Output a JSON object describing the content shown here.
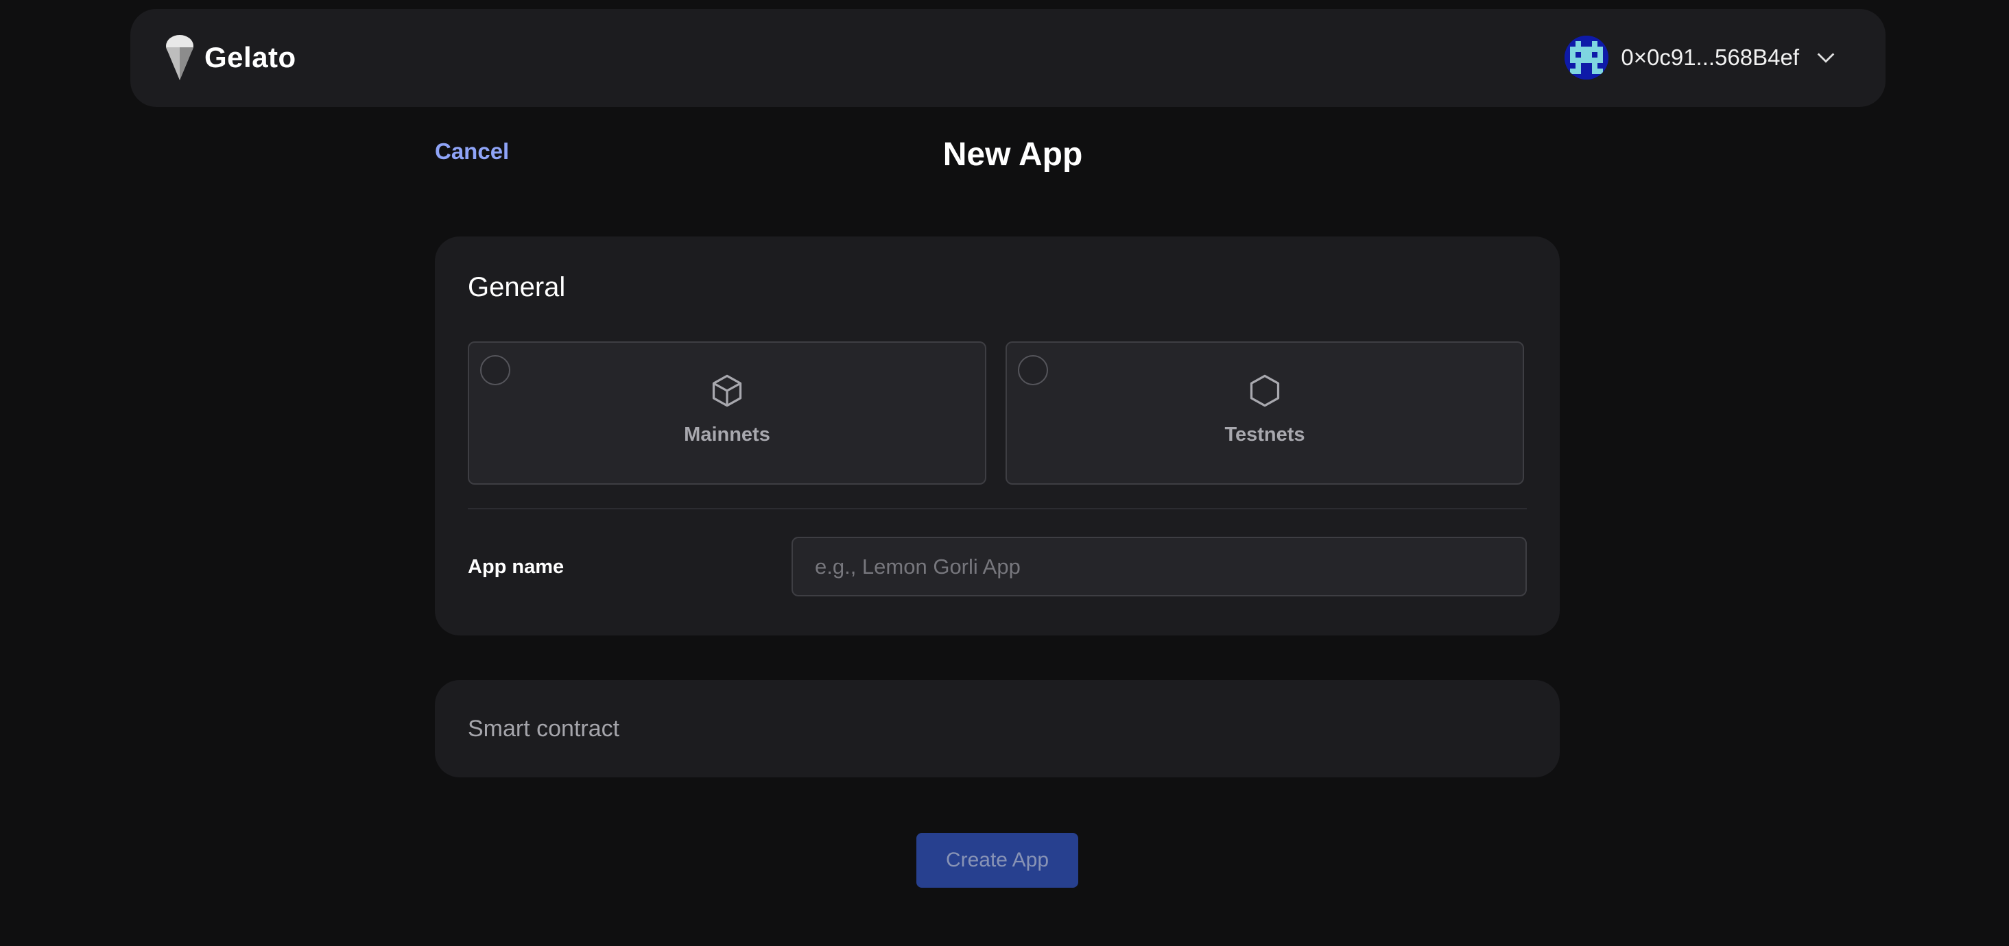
{
  "header": {
    "brand": "Gelato",
    "account_address": "0×0c91...568B4ef"
  },
  "page": {
    "cancel_label": "Cancel",
    "title": "New App"
  },
  "general": {
    "title": "General",
    "networks": [
      {
        "label": "Mainnets",
        "icon": "cube-icon",
        "selected": false
      },
      {
        "label": "Testnets",
        "icon": "hexagon-icon",
        "selected": false
      }
    ],
    "app_name_label": "App name",
    "app_name_value": "",
    "app_name_placeholder": "e.g., Lemon Gorli App"
  },
  "smart_contract": {
    "title": "Smart contract"
  },
  "actions": {
    "create_label": "Create App"
  },
  "colors": {
    "background": "#0f0f10",
    "card": "#1c1c1f",
    "accent_link": "#8fa4f7",
    "button_disabled": "#27408f"
  }
}
